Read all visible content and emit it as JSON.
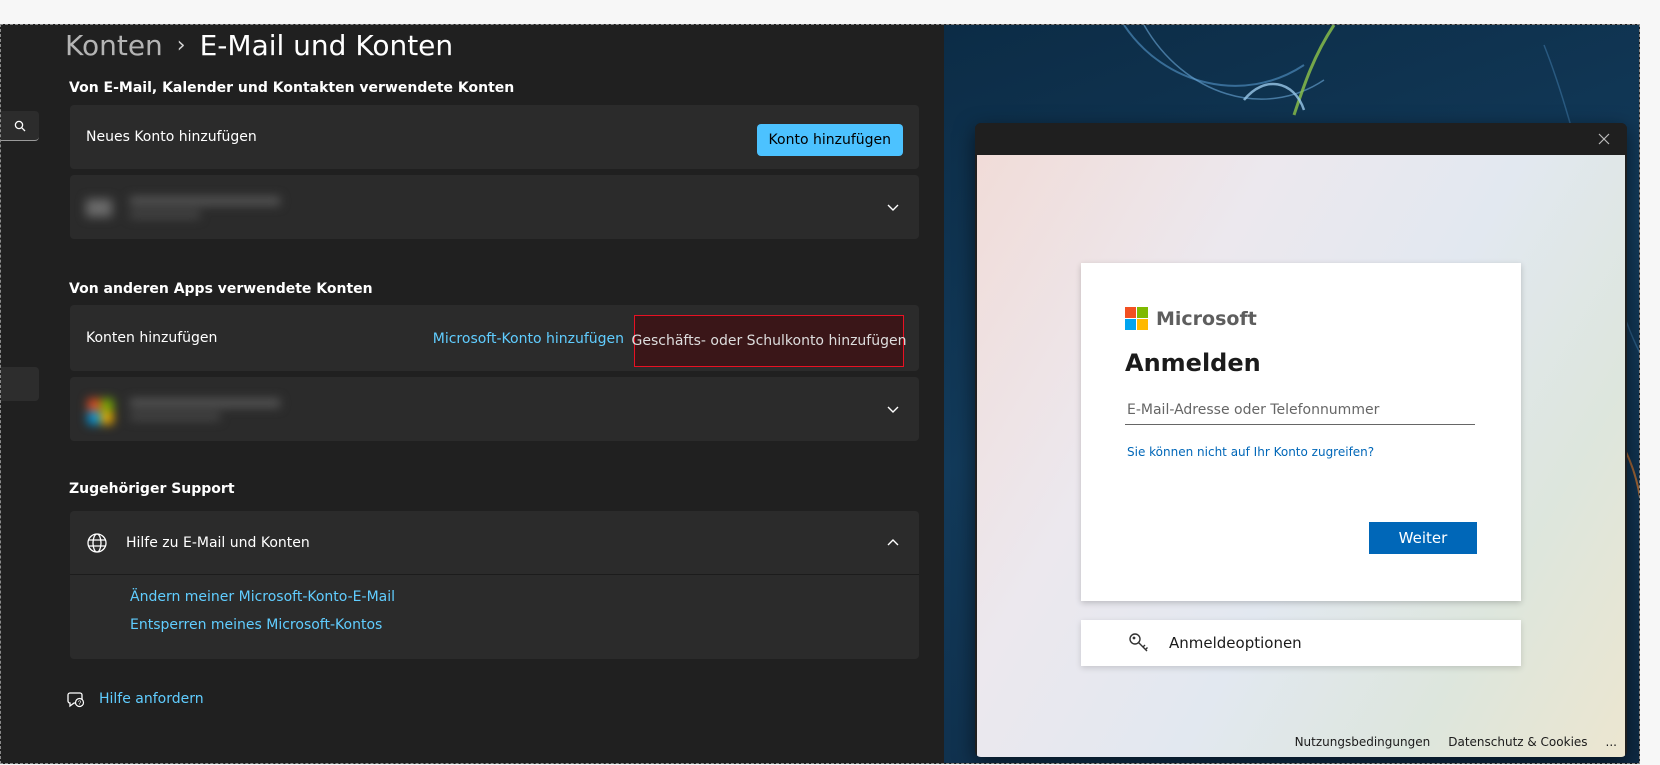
{
  "breadcrumb": {
    "parent": "Konten",
    "separator": "›",
    "current": "E-Mail und Konten"
  },
  "email_accounts": {
    "heading": "Von E-Mail, Kalender und Kontakten verwendete Konten",
    "add_label": "Neues Konto hinzufügen",
    "add_button": "Konto hinzufügen"
  },
  "other_apps": {
    "heading": "Von anderen Apps verwendete Konten",
    "add_label": "Konten hinzufügen",
    "ms_account_link": "Microsoft-Konto hinzufügen",
    "work_account_button": "Geschäfts- oder Schulkonto hinzufügen"
  },
  "support": {
    "heading": "Zugehöriger Support",
    "help_title": "Hilfe zu E-Mail und Konten",
    "links": [
      "Ändern meiner Microsoft-Konto-E-Mail",
      "Entsperren meines Microsoft-Kontos"
    ]
  },
  "get_help": "Hilfe anfordern",
  "signin": {
    "brand": "Microsoft",
    "title": "Anmelden",
    "email_placeholder": "E-Mail-Adresse oder Telefonnummer",
    "cant_access": "Sie können nicht auf Ihr Konto zugreifen?",
    "next_button": "Weiter",
    "options": "Anmeldeoptionen",
    "footer": {
      "terms": "Nutzungsbedingungen",
      "privacy": "Datenschutz & Cookies",
      "more": "..."
    }
  },
  "colors": {
    "accent": "#4cc2ff",
    "link": "#60cdff",
    "microsoft_blue": "#0067b8",
    "highlight_border": "#e81123",
    "ms_logo": [
      "#f25022",
      "#7fba00",
      "#00a4ef",
      "#ffb900"
    ]
  }
}
